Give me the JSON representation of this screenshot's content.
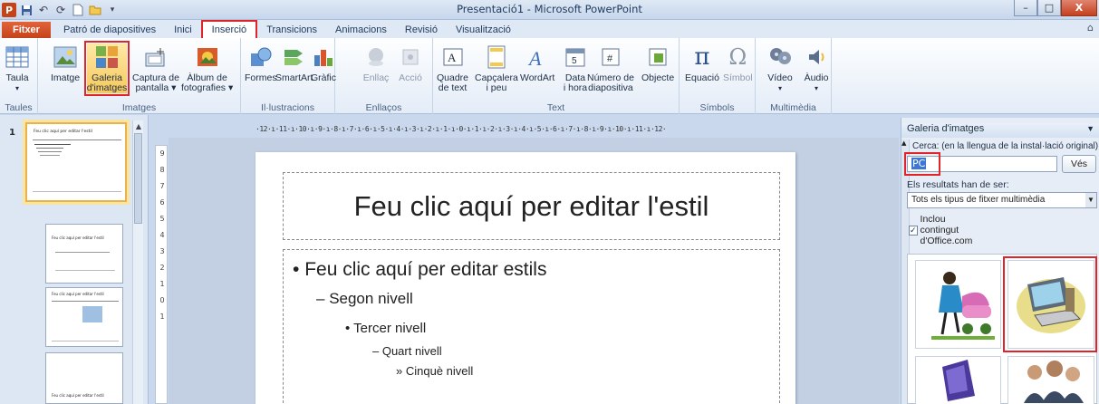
{
  "window": {
    "title": "Presentació1 - Microsoft PowerPoint",
    "app_icon": "P",
    "controls": {
      "minimize": "–",
      "maximize": "□",
      "close": "X"
    }
  },
  "quick_access": [
    "save-icon",
    "undo-icon",
    "redo-icon",
    "new-icon",
    "open-icon",
    "customize-icon"
  ],
  "tabs": [
    {
      "label": "Fitxer"
    },
    {
      "label": "Patró de diapositives"
    },
    {
      "label": "Inici"
    },
    {
      "label": "Inserció"
    },
    {
      "label": "Transicions"
    },
    {
      "label": "Animacions"
    },
    {
      "label": "Revisió"
    },
    {
      "label": "Visualització"
    }
  ],
  "ribbon": {
    "groups": {
      "taules": "Taules",
      "imatges": "Imatges",
      "illustracions": "Il·lustracions",
      "enllacos": "Enllaços",
      "text": "Text",
      "simbols": "Símbols",
      "multimedia": "Multimèdia"
    },
    "buttons": {
      "taula": "Taula",
      "imatge": "Imatge",
      "galeria_1": "Galeria",
      "galeria_2": "d'imatges",
      "captura_1": "Captura de",
      "captura_2": "pantalla ▾",
      "album_1": "Àlbum de",
      "album_2": "fotografies ▾",
      "formes": "Formes",
      "smartart": "SmartArt",
      "grafic": "Gràfic",
      "enllac": "Enllaç",
      "accio": "Acció",
      "quadre_1": "Quadre",
      "quadre_2": "de text",
      "capcalera_1": "Capçalera",
      "capcalera_2": "i peu",
      "wordart": "WordArt",
      "data_1": "Data",
      "data_2": "i hora",
      "numero_1": "Número de",
      "numero_2": "diapositiva",
      "objecte": "Objecte",
      "equacio": "Equació",
      "simbol": "Símbol",
      "video": "Vídeo",
      "audio": "Àudio"
    }
  },
  "thumbnails": {
    "number": "1",
    "master_title": "Feu clic aquí per editar l'estil",
    "layout_title": "Feu clic aquí per editar l'estil"
  },
  "ruler": {
    "horizontal": "·12·ı·11·ı·10·ı·9·ı·8·ı·7·ı·6·ı·5·ı·4·ı·3·ı·2·ı·1·ı·0·ı·1·ı·2·ı·3·ı·4·ı·5·ı·6·ı·7·ı·8·ı·9·ı·10·ı·11·ı·12·",
    "vertical": [
      "9",
      "8",
      "7",
      "6",
      "5",
      "4",
      "3",
      "2",
      "1",
      "0",
      "1"
    ]
  },
  "slide": {
    "title": "Feu clic aquí per editar l'estil",
    "level1": "Feu clic aquí per editar estils",
    "level2": "Segon nivell",
    "level3": "Tercer nivell",
    "level4": "Quart nivell",
    "level5": "Cinquè nivell"
  },
  "taskpane": {
    "title": "Galeria d'imatges",
    "search_label": "Cerca: (en la llengua de la instal·lació original)",
    "search_value": "PC",
    "go_button": "Vés",
    "results_label": "Els resultats han de ser:",
    "results_type": "Tots els tipus de fitxer multimèdia",
    "include_label": "Inclou contingut d'Office.com",
    "include_checked": "✓"
  },
  "colors": {
    "highlight": "#e0252a",
    "file_tab": "#c4431b",
    "selection": "#3b78d6"
  }
}
